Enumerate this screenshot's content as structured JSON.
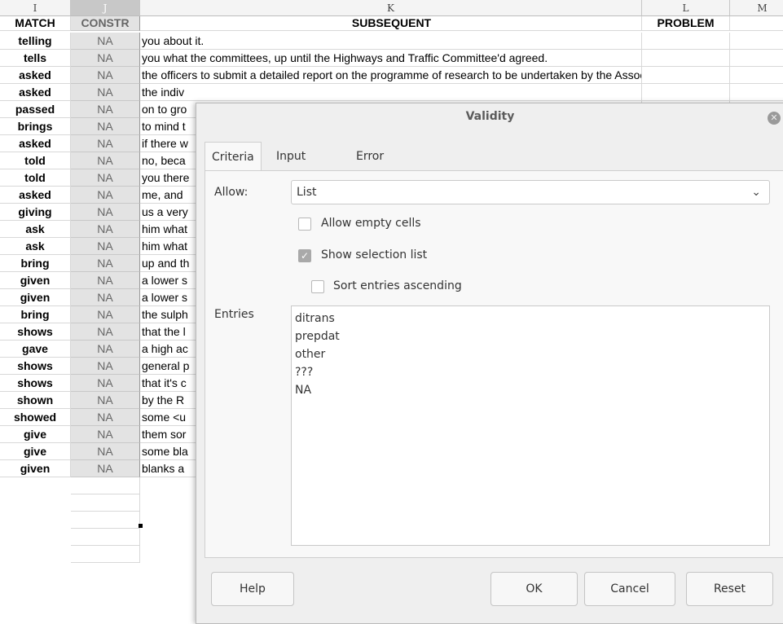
{
  "sheet": {
    "columns": [
      "I",
      "J",
      "K",
      "L",
      "M"
    ],
    "header_row": {
      "match": "MATCH",
      "constr": "CONSTR",
      "subsequent": "SUBSEQUENT",
      "problem": "PROBLEM"
    },
    "rows": [
      {
        "match": "telling",
        "constr": "NA",
        "subsequent": "you about it."
      },
      {
        "match": "tells",
        "constr": "NA",
        "subsequent": "you what the committees, up until the Highways and Traffic Committee'd agreed."
      },
      {
        "match": "asked",
        "constr": "NA",
        "subsequent": "the officers to submit a detailed report on the programme of research to be undertaken by the Associati"
      },
      {
        "match": "asked",
        "constr": "NA",
        "subsequent": "the indiv"
      },
      {
        "match": "passed",
        "constr": "NA",
        "subsequent": "on to gro"
      },
      {
        "match": "brings",
        "constr": "NA",
        "subsequent": "to mind t"
      },
      {
        "match": "asked",
        "constr": "NA",
        "subsequent": "if there w"
      },
      {
        "match": "told",
        "constr": "NA",
        "subsequent": "no, beca"
      },
      {
        "match": "told",
        "constr": "NA",
        "subsequent": "you there"
      },
      {
        "match": "asked",
        "constr": "NA",
        "subsequent": "me, and"
      },
      {
        "match": "giving",
        "constr": "NA",
        "subsequent": "us a very"
      },
      {
        "match": "ask",
        "constr": "NA",
        "subsequent": "him what"
      },
      {
        "match": "ask",
        "constr": "NA",
        "subsequent": "him what"
      },
      {
        "match": "bring",
        "constr": "NA",
        "subsequent": "up and th"
      },
      {
        "match": "given",
        "constr": "NA",
        "subsequent": "a lower s"
      },
      {
        "match": "given",
        "constr": "NA",
        "subsequent": "a lower s"
      },
      {
        "match": "bring",
        "constr": "NA",
        "subsequent": "the sulph"
      },
      {
        "match": "shows",
        "constr": "NA",
        "subsequent": "that the l"
      },
      {
        "match": "gave",
        "constr": "NA",
        "subsequent": "a high ac"
      },
      {
        "match": "shows",
        "constr": "NA",
        "subsequent": "general p"
      },
      {
        "match": "shows",
        "constr": "NA",
        "subsequent": "that it's c"
      },
      {
        "match": "shown",
        "constr": "NA",
        "subsequent": "by the R"
      },
      {
        "match": "showed",
        "constr": "NA",
        "subsequent": "some <u"
      },
      {
        "match": "give",
        "constr": "NA",
        "subsequent": "them sor"
      },
      {
        "match": "give",
        "constr": "NA",
        "subsequent": "some bla"
      },
      {
        "match": "given",
        "constr": "NA",
        "subsequent": "blanks a"
      }
    ],
    "empty_rows": 5
  },
  "dialog": {
    "title": "Validity",
    "close_icon": "close-icon",
    "tabs": [
      "Criteria",
      "Input Help",
      "Error Alert"
    ],
    "active_tab": "Criteria",
    "allow_label": "Allow:",
    "allow_value": "List",
    "allow_empty_cells": {
      "label": "Allow empty cells",
      "checked": false
    },
    "show_selection_list": {
      "label": "Show selection list",
      "checked": true
    },
    "sort_entries": {
      "label": "Sort entries ascending",
      "checked": false
    },
    "entries_label": "Entries",
    "entries": [
      "ditrans",
      "prepdat",
      "other",
      "???",
      "NA"
    ],
    "buttons": {
      "help": "Help",
      "ok": "OK",
      "cancel": "Cancel",
      "reset": "Reset"
    }
  }
}
